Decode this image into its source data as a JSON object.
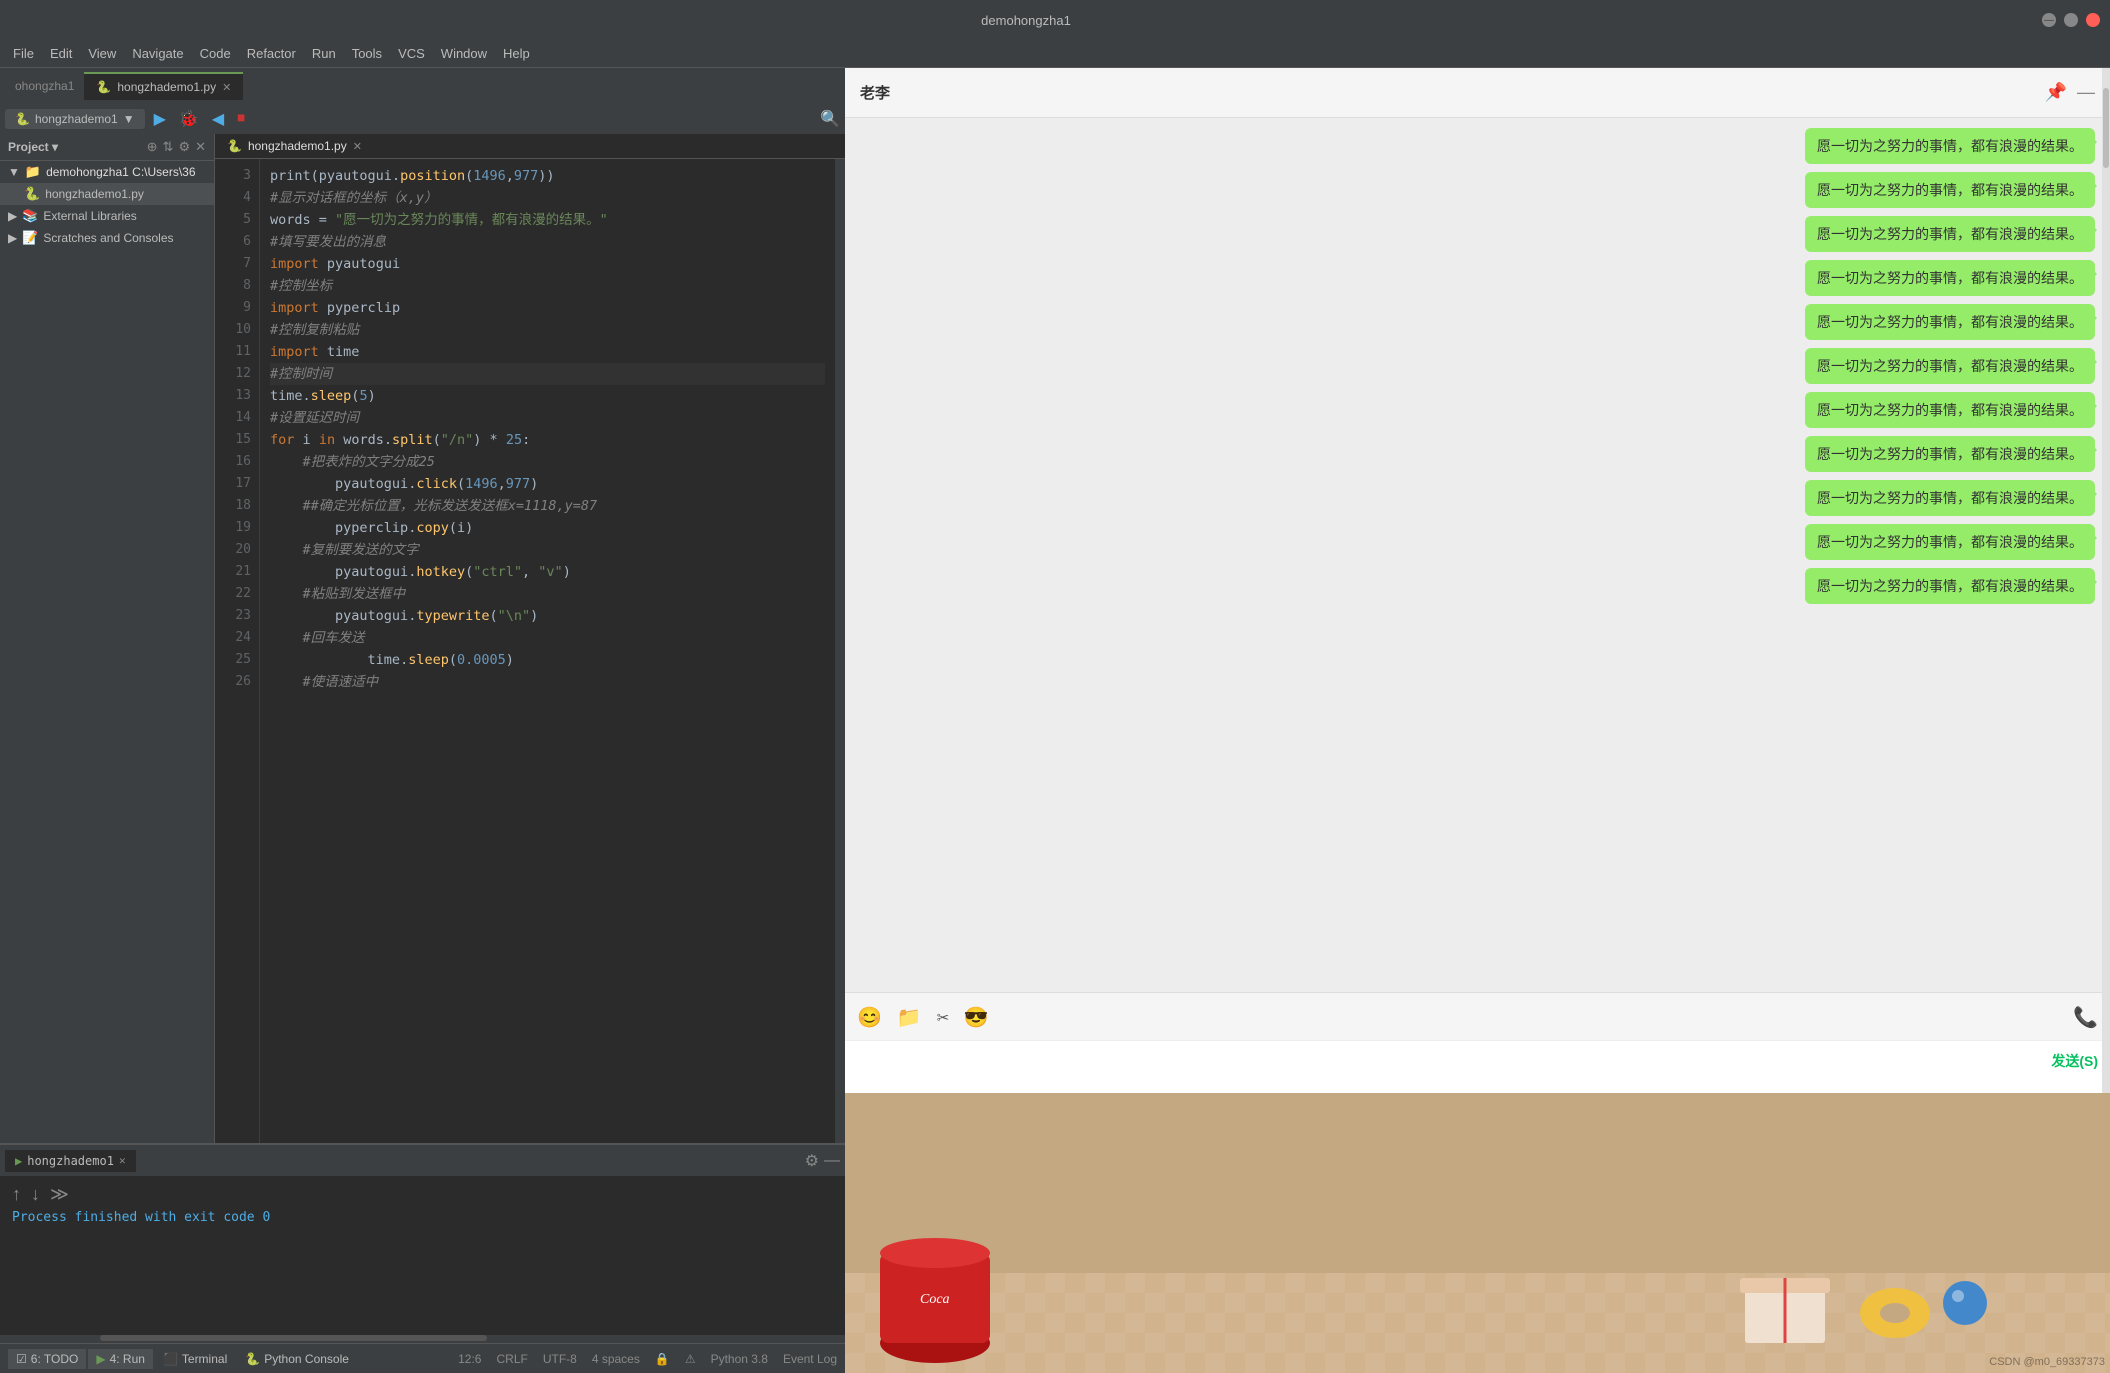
{
  "titlebar": {
    "title": "demohongzha1",
    "minimize": "—",
    "maximize": "□",
    "close": "✕"
  },
  "menubar": {
    "items": [
      "File",
      "Edit",
      "View",
      "Navigate",
      "Code",
      "Refactor",
      "Run",
      "Tools",
      "VCS",
      "Window",
      "Help"
    ]
  },
  "tabbar": {
    "breadcrumb": "ohongzha1",
    "file": "hongzhademo1.py"
  },
  "runtab": {
    "filename": "hongzhademo1",
    "runicon": "▶"
  },
  "sidebar": {
    "title": "Project",
    "items": [
      {
        "label": "demohongzha1",
        "type": "folder",
        "path": "C:\\Users\\36"
      },
      {
        "label": "hongzhademo1.py",
        "type": "pyfile"
      },
      {
        "label": "External Libraries",
        "type": "library"
      },
      {
        "label": "Scratches and Consoles",
        "type": "scratch"
      }
    ]
  },
  "editor": {
    "filename": "hongzhademo1.py",
    "lines": [
      {
        "num": 3,
        "content": "print(pyautogui.position(1496,977))"
      },
      {
        "num": 4,
        "content": "#显示对话框的坐标（x,y）"
      },
      {
        "num": 5,
        "content": "words = \"愿一切为之努力的事情，都有浪漫的结果。\""
      },
      {
        "num": 6,
        "content": "#填写要发出的消息"
      },
      {
        "num": 7,
        "content": "import pyautogui"
      },
      {
        "num": 8,
        "content": "#控制坐标"
      },
      {
        "num": 9,
        "content": "import pyperclip"
      },
      {
        "num": 10,
        "content": "#控制复制粘贴"
      },
      {
        "num": 11,
        "content": "import time"
      },
      {
        "num": 12,
        "content": "#控制时间"
      },
      {
        "num": 13,
        "content": "time.sleep(5)"
      },
      {
        "num": 14,
        "content": "#设置延迟时间"
      },
      {
        "num": 15,
        "content": "for i in words.split(\"/n\") * 25:"
      },
      {
        "num": 16,
        "content": "    #把表炸的文字分成25"
      },
      {
        "num": 17,
        "content": "        pyautogui.click(1496,977)"
      },
      {
        "num": 18,
        "content": "    ##确定光标位置，光标发送发送框x=1118,y=87"
      },
      {
        "num": 19,
        "content": "        pyperclip.copy(i)"
      },
      {
        "num": 20,
        "content": "    #复制要发送的文字"
      },
      {
        "num": 21,
        "content": "        pyautogui.hotkey(\"ctrl\", \"v\")"
      },
      {
        "num": 22,
        "content": "    #粘贴到发送框中"
      },
      {
        "num": 23,
        "content": "        pyautogui.typewrite(\"\\n\")"
      },
      {
        "num": 24,
        "content": "    #回车发送"
      },
      {
        "num": 25,
        "content": "            time.sleep(0.0005)"
      },
      {
        "num": 26,
        "content": "    #使语速适中"
      }
    ]
  },
  "runpanel": {
    "tab": "hongzhademo1",
    "output": "Process finished with exit code 0"
  },
  "statusbar": {
    "tabs": [
      "6: TODO",
      "4: Run",
      "Terminal",
      "Python Console"
    ],
    "position": "12:6",
    "crlf": "CRLF",
    "encoding": "UTF-8",
    "indent": "4 spaces",
    "python": "Python 3.8",
    "event_log": "Event Log"
  },
  "chat": {
    "contact_name": "老李",
    "messages": [
      "愿一切为之努力的事情，都有浪漫的结果。",
      "愿一切为之努力的事情，都有浪漫的结果。",
      "愿一切为之努力的事情，都有浪漫的结果。",
      "愿一切为之努力的事情，都有浪漫的结果。",
      "愿一切为之努力的事情，都有浪漫的结果。",
      "愿一切为之努力的事情，都有浪漫的结果。",
      "愿一切为之努力的事情，都有浪漫的结果。",
      "愿一切为之努力的事情，都有浪漫的结果。",
      "愿一切为之努力的事情，都有浪漫的结果。",
      "愿一切为之努力的事情，都有浪漫的结果。",
      "愿一切为之努力的事情，都有浪漫的结果。"
    ],
    "send_btn_label": "发送(S)",
    "toolbar_icons": [
      "emoji",
      "folder",
      "scissors",
      "emoji2"
    ],
    "watermark": "CSDN @m0_69337373"
  }
}
